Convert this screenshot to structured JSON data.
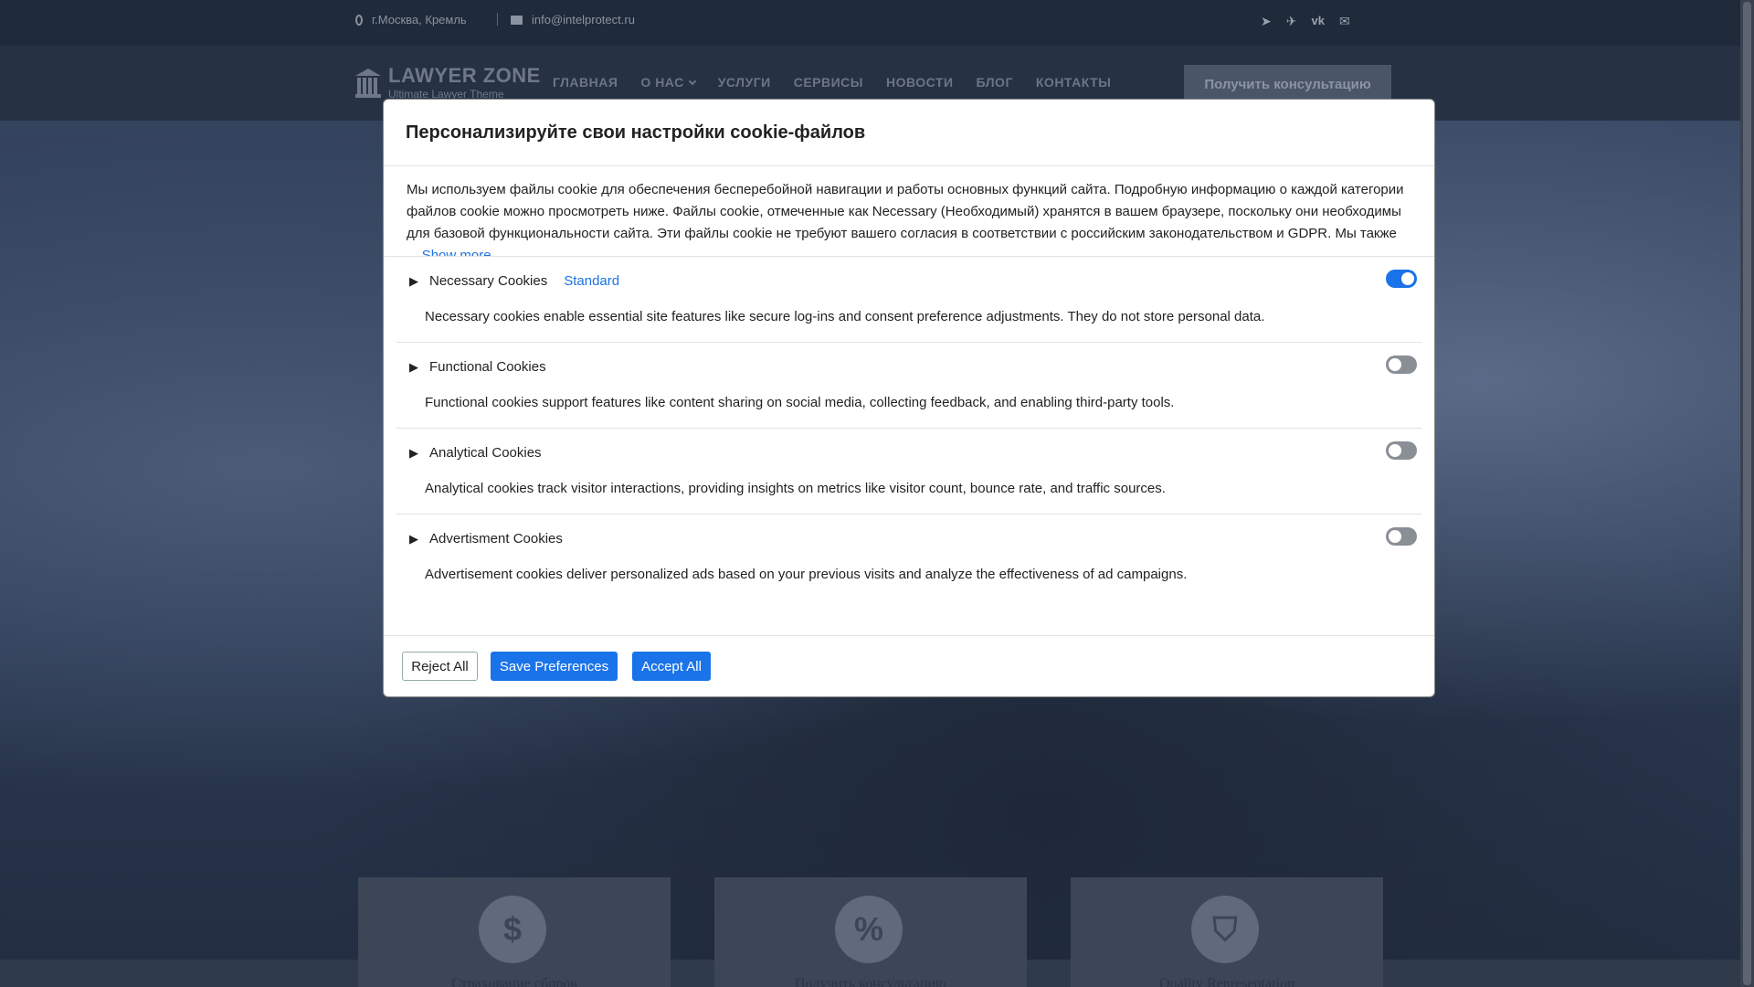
{
  "topbar": {
    "address": "г.Москва, Кремль",
    "email": "info@intelprotect.ru",
    "social_icons": [
      "paper-plane-icon",
      "telegram-icon",
      "vk-icon",
      "envelope-icon"
    ]
  },
  "logo": {
    "main": "LAWYER ZONE",
    "sub": "Ultimate Lawyer Theme"
  },
  "nav": {
    "items": [
      "ГЛАВНАЯ",
      "О НАС",
      "УСЛУГИ",
      "СЕРВИСЫ",
      "НОВОСТИ",
      "БЛОГ",
      "КОНТАКТЫ"
    ],
    "cta": "Получить консультацию"
  },
  "cards": [
    {
      "icon": "money-icon",
      "title": "Страхование сборов"
    },
    {
      "icon": "percent-icon",
      "title": "Получить консультацию"
    },
    {
      "icon": "shield-icon",
      "title": "Quality Representation"
    }
  ],
  "modal": {
    "title": "Персонализируйте свои настройки cookie-файлов",
    "intro": "Мы используем файлы cookie для обеспечения бесперебойной навигации и работы основных функций сайта. Подробную информацию о каждой категории файлов cookie можно просмотреть ниже. Файлы cookie, отмеченные как Necessary (Необходимый) хранятся в вашем браузере, поскольку они необходимы для базовой функциональности сайта. Эти файлы cookie не требуют вашего согласия в соответствии с российским законодательством и GDPR. Мы также используем сторонние файлы cookie для анализа использования сайта, запоминания ваших предпочтений и предоставления релевантного контента. Они будут",
    "ellipsis": "...",
    "show_more": "Show more",
    "categories": [
      {
        "name": "Necessary Cookies",
        "badge": "Standard",
        "enabled": true,
        "desc": "Necessary cookies enable essential site features like secure log-ins and consent preference adjustments. They do not store personal data."
      },
      {
        "name": "Functional Cookies",
        "badge": "",
        "enabled": false,
        "desc": "Functional cookies support features like content sharing on social media, collecting feedback, and enabling third-party tools."
      },
      {
        "name": "Analytical Cookies",
        "badge": "",
        "enabled": false,
        "desc": "Analytical cookies track visitor interactions, providing insights on metrics like visitor count, bounce rate, and traffic sources."
      },
      {
        "name": "Advertisment Cookies",
        "badge": "",
        "enabled": false,
        "desc": "Advertisement cookies deliver personalized ads based on your previous visits and analyze the effectiveness of ad campaigns."
      }
    ],
    "buttons": {
      "reject": "Reject All",
      "save": "Save Preferences",
      "accept": "Accept All"
    }
  },
  "colors": {
    "accent": "#1a73e8",
    "topbar": "#1f2a3a",
    "navbar": "#263244"
  }
}
